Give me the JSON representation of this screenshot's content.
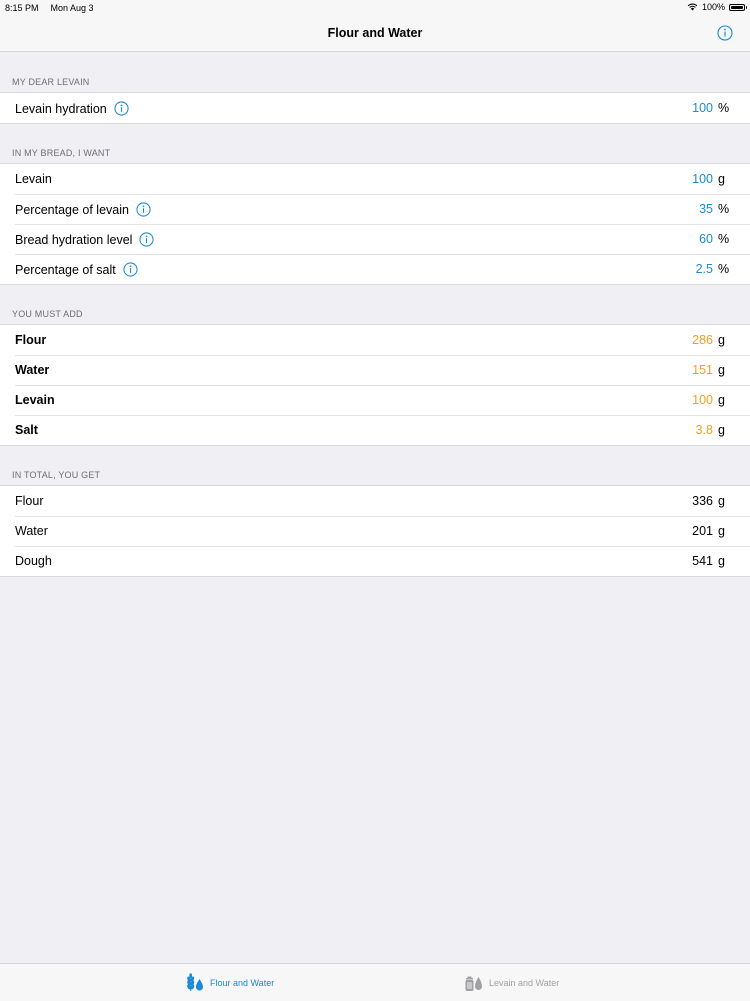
{
  "status": {
    "time": "8:15 PM",
    "date": "Mon Aug 3",
    "battery": "100%"
  },
  "nav": {
    "title": "Flour and Water"
  },
  "sections": {
    "levain": {
      "header": "MY DEAR LEVAIN",
      "rows": [
        {
          "label": "Levain hydration",
          "value": "100",
          "unit": "%"
        }
      ]
    },
    "want": {
      "header": "IN MY BREAD, I WANT",
      "rows": [
        {
          "label": "Levain",
          "value": "100",
          "unit": "g"
        },
        {
          "label": "Percentage of levain",
          "value": "35",
          "unit": "%"
        },
        {
          "label": "Bread hydration level",
          "value": "60",
          "unit": "%"
        },
        {
          "label": "Percentage of salt",
          "value": "2.5",
          "unit": "%"
        }
      ]
    },
    "add": {
      "header": "YOU MUST ADD",
      "rows": [
        {
          "label": "Flour",
          "value": "286",
          "unit": "g"
        },
        {
          "label": "Water",
          "value": "151",
          "unit": "g"
        },
        {
          "label": "Levain",
          "value": "100",
          "unit": "g"
        },
        {
          "label": "Salt",
          "value": "3.8",
          "unit": "g"
        }
      ]
    },
    "total": {
      "header": "IN TOTAL, YOU GET",
      "rows": [
        {
          "label": "Flour",
          "value": "336",
          "unit": "g"
        },
        {
          "label": "Water",
          "value": "201",
          "unit": "g"
        },
        {
          "label": "Dough",
          "value": "541",
          "unit": "g"
        }
      ]
    }
  },
  "tabs": [
    {
      "label": "Flour and Water",
      "icon": "wheat-water-icon",
      "active": true
    },
    {
      "label": "Levain and Water",
      "icon": "jar-water-icon",
      "active": false
    }
  ],
  "colors": {
    "accent": "#1a8ad6",
    "result": "#f0a020",
    "background": "#efeff4"
  }
}
